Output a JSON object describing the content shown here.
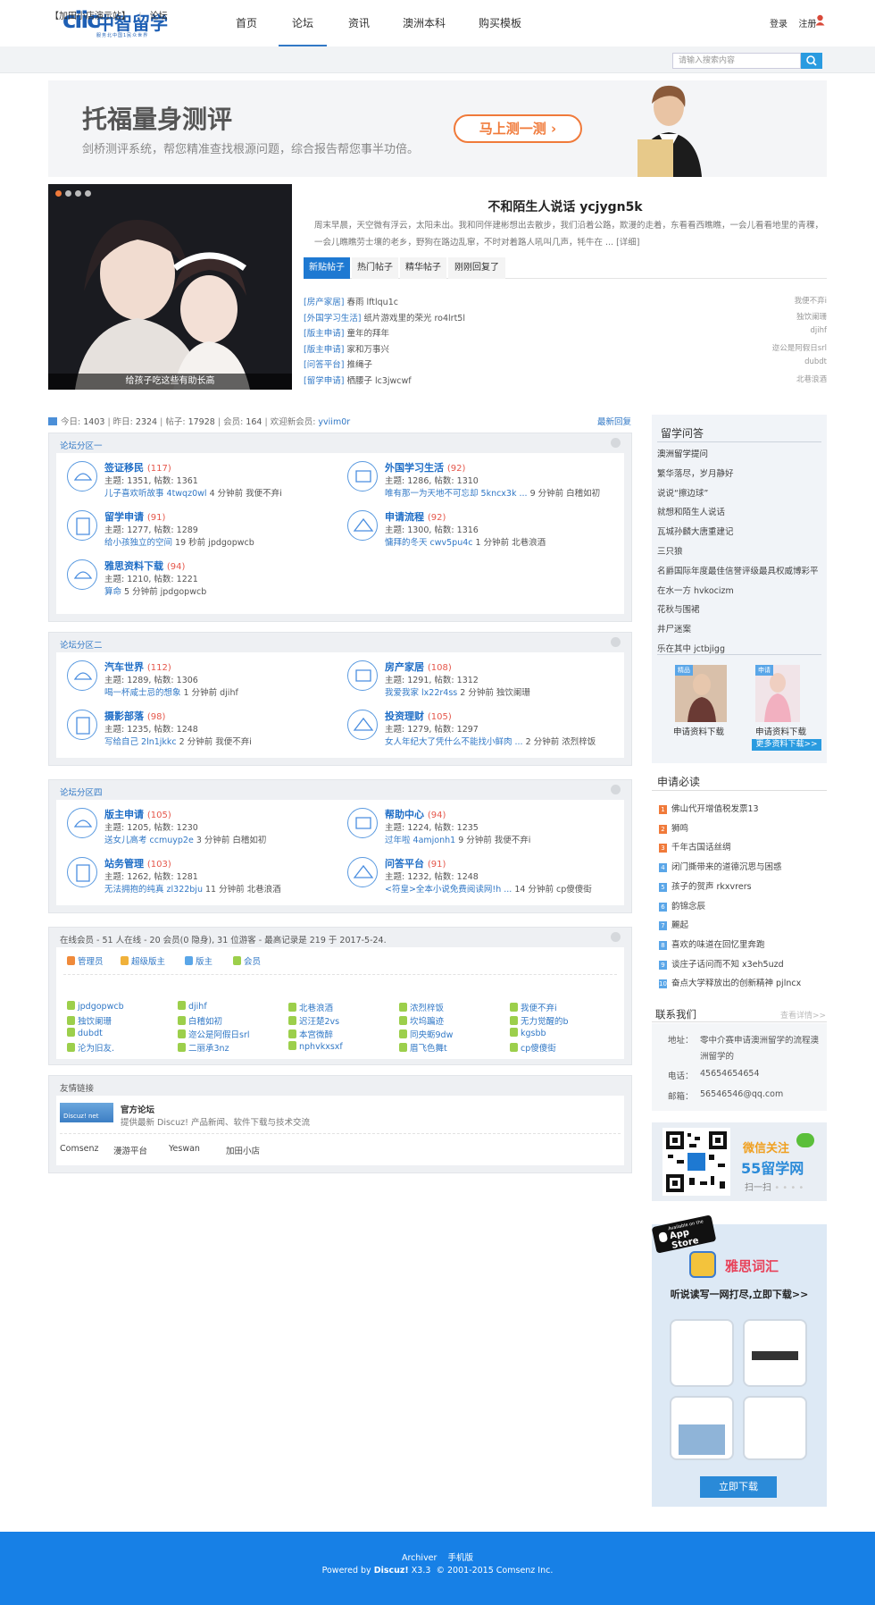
{
  "header": {
    "logo_mark": "ciic",
    "logo_text": "中智留学",
    "logo_sub": "服务北中国1民众世界",
    "nav": [
      "首页",
      "论坛",
      "资讯",
      "澳洲本科",
      "购买模板"
    ],
    "login": "登录",
    "register": "注册"
  },
  "breadcrumb": {
    "site": "【加田小店演示站】",
    "current": "论坛"
  },
  "search": {
    "placeholder": "请输入搜索内容"
  },
  "banner": {
    "title": "托福量身测评",
    "subtitle": "剑桥测评系统，帮您精准查找根源问题，综合报告帮您事半功倍。",
    "button": "马上测一测"
  },
  "slider": {
    "caption": "给孩子吃这些有助长高"
  },
  "featured": {
    "title": "不和陌生人说话 ycjygn5k",
    "desc": "周末早晨，天空微有浮云，太阳未出。我和同伴建彬想出去散步，我们沿着公路，欺漫的走着，东看看西瞧瞧，一会儿看看地里的青稞，一会儿瞧瞧劳士壤的老乡，野狗在路边乱窜，不时对着路人吼叫几声，牦牛在 ... [详细]",
    "tabs": [
      "新贴帖子",
      "热门帖子",
      "精华帖子",
      "刚刚回复了"
    ],
    "posts": [
      {
        "cat": "[房产家居]",
        "title": "春雨 lftlqu1c",
        "author": "我便不弃i"
      },
      {
        "cat": "[外国学习生活]",
        "title": "纸片游戏里的荣光 ro4lrt5l",
        "author": "独饮阑珊"
      },
      {
        "cat": "[版主申请]",
        "title": "童年的拜年",
        "author": "djihf"
      },
      {
        "cat": "[版主申请]",
        "title": "家和万事兴",
        "author": "迩公是阿假日srl"
      },
      {
        "cat": "[问答平台]",
        "title": "推绳子",
        "author": "dubdt"
      },
      {
        "cat": "[留学申请]",
        "title": "栖腰子 lc3jwcwf",
        "author": "北巷浪酒"
      }
    ]
  },
  "stats": {
    "today_label": "今日:",
    "today": "1403",
    "yesterday_label": "昨日:",
    "yesterday": "2324",
    "posts_label": "帖子:",
    "posts": "17928",
    "members_label": "会员:",
    "members": "164",
    "welcome_label": "欢迎新会员:",
    "new_member": "yviim0r",
    "latest": "最新回复"
  },
  "zone1": {
    "title": "论坛分区一",
    "forums": [
      {
        "name": "签证移民",
        "count": "(117)",
        "stat": "主题: 1351, 帖数: 1361",
        "last": "儿子喜欢听故事 4twqz0wl",
        "time": "4 分钟前 我便不弃i"
      },
      {
        "name": "外国学习生活",
        "count": "(92)",
        "stat": "主题: 1286, 帖数: 1310",
        "last": "唯有那一为天地不可忘却 5kncx3k ...",
        "time": "9 分钟前 白稽如初"
      },
      {
        "name": "留学申请",
        "count": "(91)",
        "stat": "主题: 1277, 帖数: 1289",
        "last": "给小孩独立的空间",
        "time": "19 秒前 jpdgopwcb"
      },
      {
        "name": "申请流程",
        "count": "(92)",
        "stat": "主题: 1300, 帖数: 1316",
        "last": "慵拜的冬天 cwv5pu4c",
        "time": "1 分钟前 北巷浪酒"
      },
      {
        "name": "雅思资料下载",
        "count": "(94)",
        "stat": "主题: 1210, 帖数: 1221",
        "last": "算命",
        "time": "5 分钟前 jpdgopwcb"
      }
    ]
  },
  "zone2": {
    "title": "论坛分区二",
    "forums": [
      {
        "name": "汽车世界",
        "count": "(112)",
        "stat": "主题: 1289, 帖数: 1306",
        "last": "喝一杯咸士忌的想象",
        "time": "1 分钟前 djihf"
      },
      {
        "name": "房产家居",
        "count": "(108)",
        "stat": "主题: 1291, 帖数: 1312",
        "last": "我爱我家 lx22r4ss",
        "time": "2 分钟前 独饮阑珊"
      },
      {
        "name": "摄影部落",
        "count": "(98)",
        "stat": "主题: 1235, 帖数: 1248",
        "last": "写给自己 2ln1jkkc",
        "time": "2 分钟前 我便不弃i"
      },
      {
        "name": "投资理财",
        "count": "(105)",
        "stat": "主题: 1279, 帖数: 1297",
        "last": "女人年纪大了凭什么不能找小鲜肉 ...",
        "time": "2 分钟前 浓烈梓饭"
      }
    ]
  },
  "zone4": {
    "title": "论坛分区四",
    "forums": [
      {
        "name": "版主申请",
        "count": "(105)",
        "stat": "主题: 1205, 帖数: 1230",
        "last": "送女儿高考 ccmuyp2e",
        "time": "3 分钟前 白稽如初"
      },
      {
        "name": "帮助中心",
        "count": "(94)",
        "stat": "主题: 1224, 帖数: 1235",
        "last": "过年啦 4amjonh1",
        "time": "9 分钟前 我便不弃i"
      },
      {
        "name": "站务管理",
        "count": "(103)",
        "stat": "主题: 1262, 帖数: 1281",
        "last": "无法拥抱的纯真 zl322bju",
        "time": "11 分钟前 北巷浪酒"
      },
      {
        "name": "问答平台",
        "count": "(91)",
        "stat": "主题: 1232, 帖数: 1248",
        "last": "<符皇>全本小说免费阅读网!h ...",
        "time": "14 分钟前 cp傻傻街"
      }
    ]
  },
  "online": {
    "title": "在线会员 - 51 人在线 - 20 会员(0 隐身), 31 位游客 - 最高记录是 219 于 2017-5-24.",
    "legend": [
      "管理员",
      "超级版主",
      "版主",
      "会员"
    ],
    "users": [
      "jpdgopwcb",
      "djihf",
      "北巷浪酒",
      "浓烈梓饭",
      "我便不弃i",
      "独饮阑珊",
      "白稽如初",
      "迟汪楚2vs",
      "坎坞蹁迹",
      "无力觉醒的b",
      "dubdt",
      "迩公是阿假日srl",
      "本宫微醉",
      "同央蛎9dw",
      "kgsbb",
      "沦为旧友.",
      "二丽承3nz",
      "nphvkxsxf",
      "眉飞色舞t",
      "cp傻傻街"
    ]
  },
  "links": {
    "title": "友情链接",
    "main_logo": "Discuz! net",
    "main_name": "官方论坛",
    "main_desc": "提供最新 Discuz! 产品新闻、软件下载与技术交流",
    "items": [
      "Comsenz",
      "漫游平台",
      "Yeswan",
      "加田小店"
    ]
  },
  "sidebar": {
    "qa_title": "留学问答",
    "qa_items": [
      "澳洲留学提问",
      "繁华落尽，岁月静好",
      "说说“擦边球”",
      "就想和陌生人说话",
      "瓦城孙麟大唐重建记",
      "三只狼",
      "名爵国际年度最佳信誉评级最具权威博彩平",
      "在水一方 hvkocizm",
      "花秋与围裙",
      "井尸迷案",
      "乐在其中 jctbjigg"
    ],
    "dl_items": [
      {
        "tag": "精品",
        "label": "申请资料下载"
      },
      {
        "tag": "申请",
        "label": "申请资料下载"
      }
    ],
    "more": "更多资料下载>>",
    "must_title": "申请必读",
    "must_items": [
      "佛山代开增值税发票13",
      "狮鸣",
      "千年古国话丝绸",
      "闭门撕带来的道德沉思与困惑",
      "孩子的贺声 rkxvrers",
      "韵锦念辰",
      "麗起",
      "喜欢的味道在回忆里奔跑",
      "谈庄子话问而不知 x3eh5uzd",
      "奋点大学释放出的创新精神 pjlncx"
    ],
    "contact_title": "联系我们",
    "contact_more": "查看详情>>",
    "addr_label": "地址：",
    "addr": "零中介赛申请澳洲留学的流程澳洲留学的",
    "tel_label": "电话：",
    "tel": "45654654654",
    "mail_label": "邮箱：",
    "mail": "56546546@qq.com",
    "wechat_title": "微信关注",
    "wechat_name": "55留学网",
    "wechat_scan": "扫一扫",
    "app_store_small": "Available on the",
    "app_store": "App Store",
    "app_title": "雅思词汇",
    "app_sub": "听说读写一网打尽,立即下载>>",
    "app_btn": "立即下载"
  },
  "footer": {
    "links": [
      "Archiver",
      "手机版"
    ],
    "powered": "Powered by",
    "product": "Discuz!",
    "version": "X3.3",
    "copyright": "© 2001-2015 Comsenz Inc."
  },
  "colors": {
    "accent": "#1e79d2",
    "footer": "#1780e6",
    "orange": "#f07a3a"
  }
}
